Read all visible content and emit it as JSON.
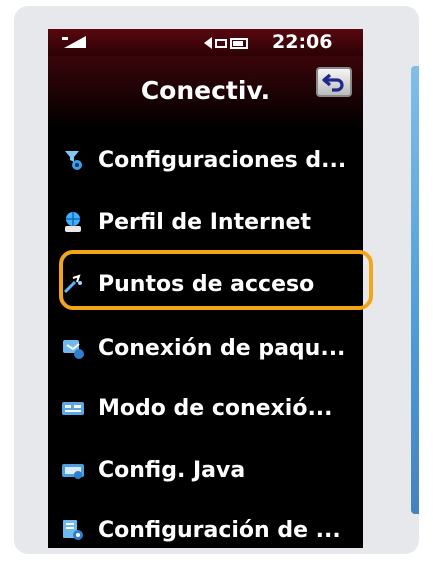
{
  "status_bar": {
    "time": "22:06",
    "icons": [
      "signal-icon",
      "arrow-icon",
      "message-icon",
      "battery-icon"
    ]
  },
  "header": {
    "title": "Conectiv.",
    "back_icon": "back-arrow-icon"
  },
  "menu": {
    "items": [
      {
        "label": "Configuraciones d...",
        "icon": "settings-network-icon"
      },
      {
        "label": "Perfil de Internet",
        "icon": "internet-profile-icon"
      },
      {
        "label": "Puntos de acceso",
        "icon": "access-point-icon",
        "highlighted": true
      },
      {
        "label": "Conexión de paqu...",
        "icon": "packet-connection-icon"
      },
      {
        "label": "Modo de conexió...",
        "icon": "connection-mode-icon"
      },
      {
        "label": "Config. Java",
        "icon": "java-icon"
      },
      {
        "label": "Configuración de ...",
        "icon": "configuration-icon"
      }
    ]
  },
  "colors": {
    "highlight": "#f3a51a",
    "header_red": "#5a0710",
    "frame": "#e7e8ec"
  }
}
